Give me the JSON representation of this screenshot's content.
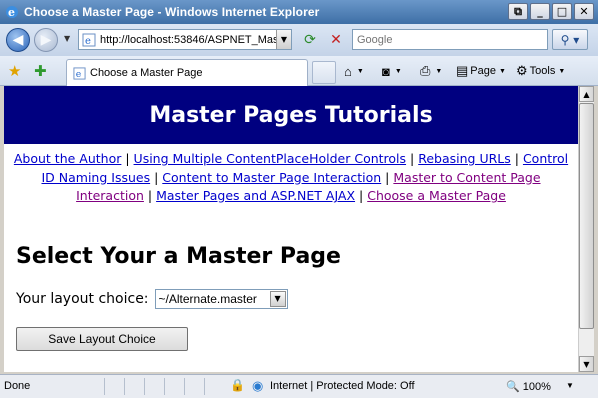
{
  "window": {
    "title": "Choose a Master Page - Windows Internet Explorer",
    "controls": {
      "restore": "⧉",
      "minimize": "_",
      "maximize": "□",
      "close": "✕"
    }
  },
  "address_bar": {
    "url": "http://localhost:53846/ASPNET_Mas",
    "search_placeholder": "Google"
  },
  "tab": {
    "title": "Choose a Master Page"
  },
  "commands": {
    "page": "Page",
    "tools": "Tools"
  },
  "page": {
    "banner": "Master Pages Tutorials",
    "nav_links": [
      {
        "label": "About the Author",
        "visited": false
      },
      {
        "label": "Using Multiple ContentPlaceHolder Controls",
        "visited": false
      },
      {
        "label": "Rebasing URLs",
        "visited": false
      },
      {
        "label": "Control ID Naming Issues",
        "visited": false
      },
      {
        "label": "Content to Master Page Interaction",
        "visited": false
      },
      {
        "label": "Master to Content Page Interaction",
        "visited": true
      },
      {
        "label": "Master Pages and ASP.NET AJAX",
        "visited": false
      },
      {
        "label": "Choose a Master Page",
        "visited": true
      }
    ],
    "heading": "Select Your a Master Page",
    "layout_label": "Your layout choice:",
    "layout_selected": "~/Alternate.master",
    "save_button": "Save Layout Choice"
  },
  "status": {
    "text": "Done",
    "zone": "Internet | Protected Mode: Off",
    "zoom": "100%"
  },
  "icons": {
    "back": "back-arrow-icon",
    "forward": "forward-arrow-icon",
    "refresh": "refresh-icon",
    "stop": "stop-icon",
    "search": "search-icon",
    "favorites": "favorites-star-icon",
    "add_favorites": "add-favorites-icon",
    "home": "home-icon",
    "feeds": "feeds-icon",
    "print": "print-icon",
    "page": "page-icon",
    "tools": "gear-icon"
  },
  "colors": {
    "banner_bg": "#000080",
    "link": "#0000cc",
    "visited_link": "#800080"
  }
}
